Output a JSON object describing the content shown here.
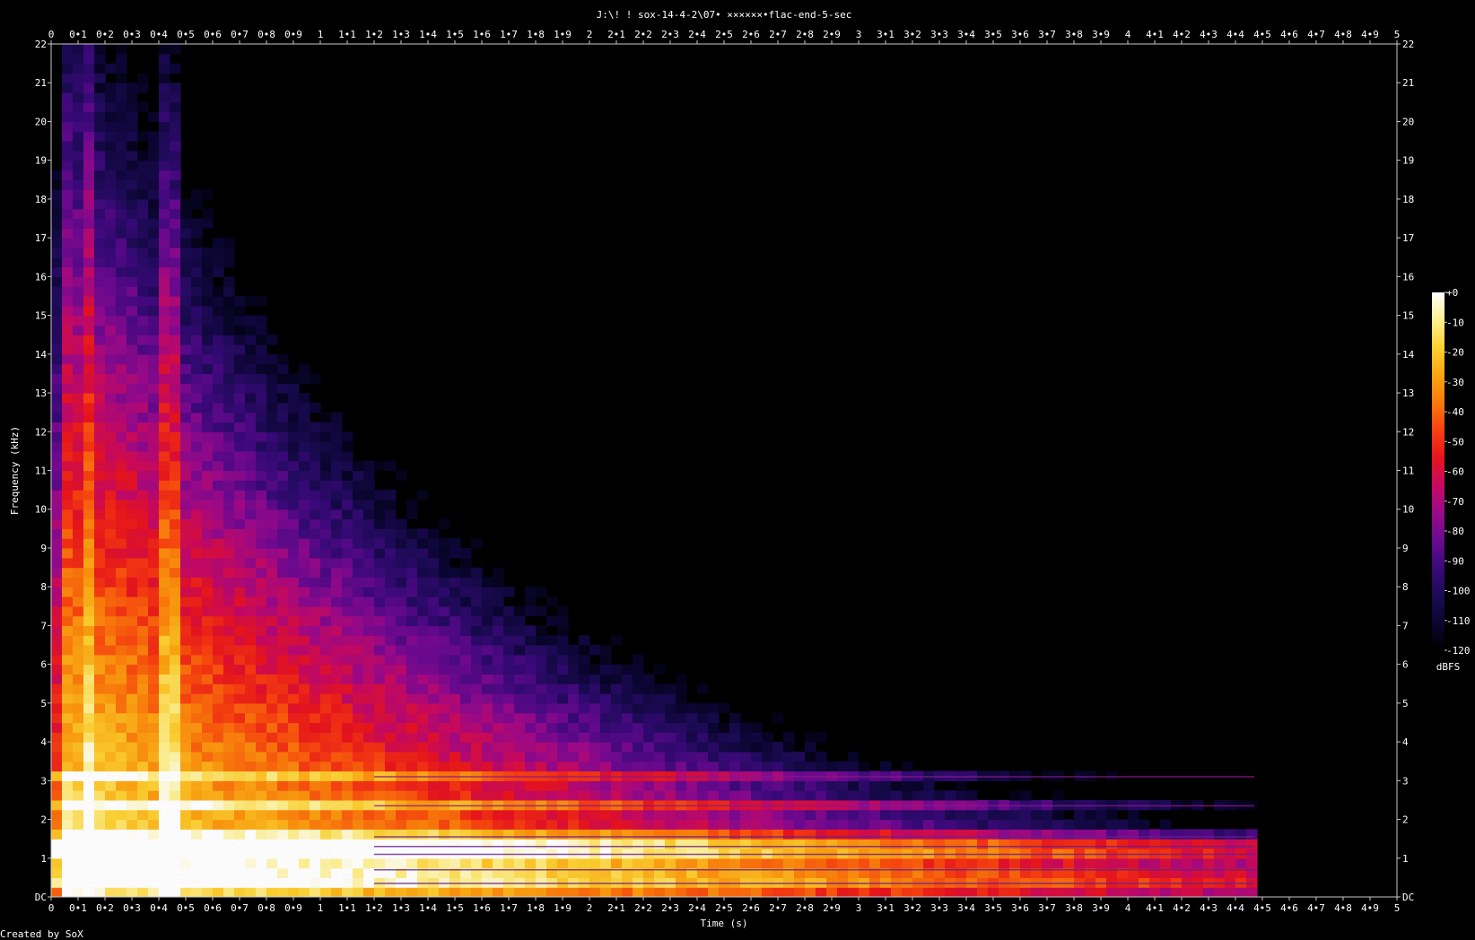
{
  "chart_data": {
    "type": "heatmap",
    "title": "J:\\! ! sox-14-4-2\\07• ××××××•flac-end-5-sec",
    "xlabel": "Time (s)",
    "ylabel": "Frequency (kHz)",
    "footer": "Created by SoX",
    "xlim": [
      0,
      5
    ],
    "ylim": [
      0,
      22
    ],
    "x_ticks": [
      "0",
      "0•1",
      "0•2",
      "0•3",
      "0•4",
      "0•5",
      "0•6",
      "0•7",
      "0•8",
      "0•9",
      "1",
      "1•1",
      "1•2",
      "1•3",
      "1•4",
      "1•5",
      "1•6",
      "1•7",
      "1•8",
      "1•9",
      "2",
      "2•1",
      "2•2",
      "2•3",
      "2•4",
      "2•5",
      "2•6",
      "2•7",
      "2•8",
      "2•9",
      "3",
      "3•1",
      "3•2",
      "3•3",
      "3•4",
      "3•5",
      "3•6",
      "3•7",
      "3•8",
      "3•9",
      "4",
      "4•1",
      "4•2",
      "4•3",
      "4•4",
      "4•5",
      "4•6",
      "4•7",
      "4•8",
      "4•9",
      "5"
    ],
    "y_ticks": [
      "DC",
      "1",
      "2",
      "3",
      "4",
      "5",
      "6",
      "7",
      "8",
      "9",
      "10",
      "11",
      "12",
      "13",
      "14",
      "15",
      "16",
      "17",
      "18",
      "19",
      "20",
      "21",
      "22"
    ],
    "colorbar": {
      "label": "dBFS",
      "ticks": [
        "+0",
        "-10",
        "-20",
        "-30",
        "-40",
        "-50",
        "-60",
        "-70",
        "-80",
        "-90",
        "-100",
        "-110",
        "-120"
      ],
      "range": [
        -120,
        0
      ],
      "colors": [
        "#000000",
        "#0b0630",
        "#1c0b55",
        "#3a0a7a",
        "#6a0a90",
        "#9a0a8a",
        "#c80a60",
        "#e8141e",
        "#f84010",
        "#fb7a0c",
        "#fca412",
        "#fdd030",
        "#fef090",
        "#ffffff"
      ]
    },
    "signal": {
      "end_time_s": 4.47,
      "attack_peak_time_s": 0.45,
      "harmonics_khz": [
        0.35,
        0.7,
        1.1,
        1.3,
        1.55,
        2.35,
        3.1
      ],
      "grid": false
    }
  }
}
